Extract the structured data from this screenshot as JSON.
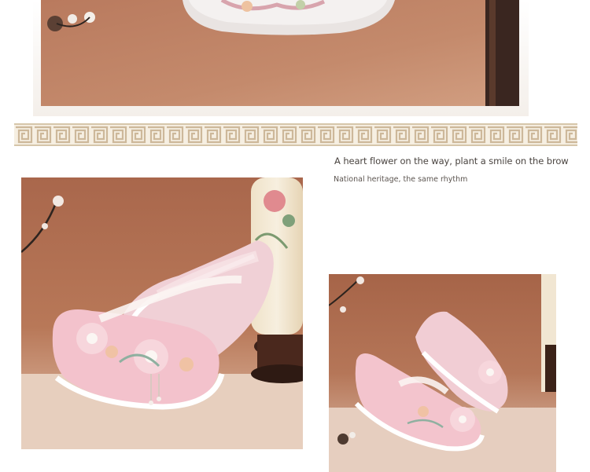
{
  "captions": {
    "line_1": "A heart flower on the way, plant a smile on the brow",
    "line_2": "National heritage, the same rhythm"
  },
  "photos": {
    "top": "pink-embroidered-shoe-closeup",
    "left": "pair-of-pink-embroidered-shoes-with-pearl-tassels",
    "right": "pair-of-pink-mesh-shoes-side-view"
  },
  "colors": {
    "backdrop_brown": "#b4745a",
    "shoe_pink": "#f2c4cc",
    "fret_gold": "#cdb89a",
    "text": "#4a4440"
  }
}
